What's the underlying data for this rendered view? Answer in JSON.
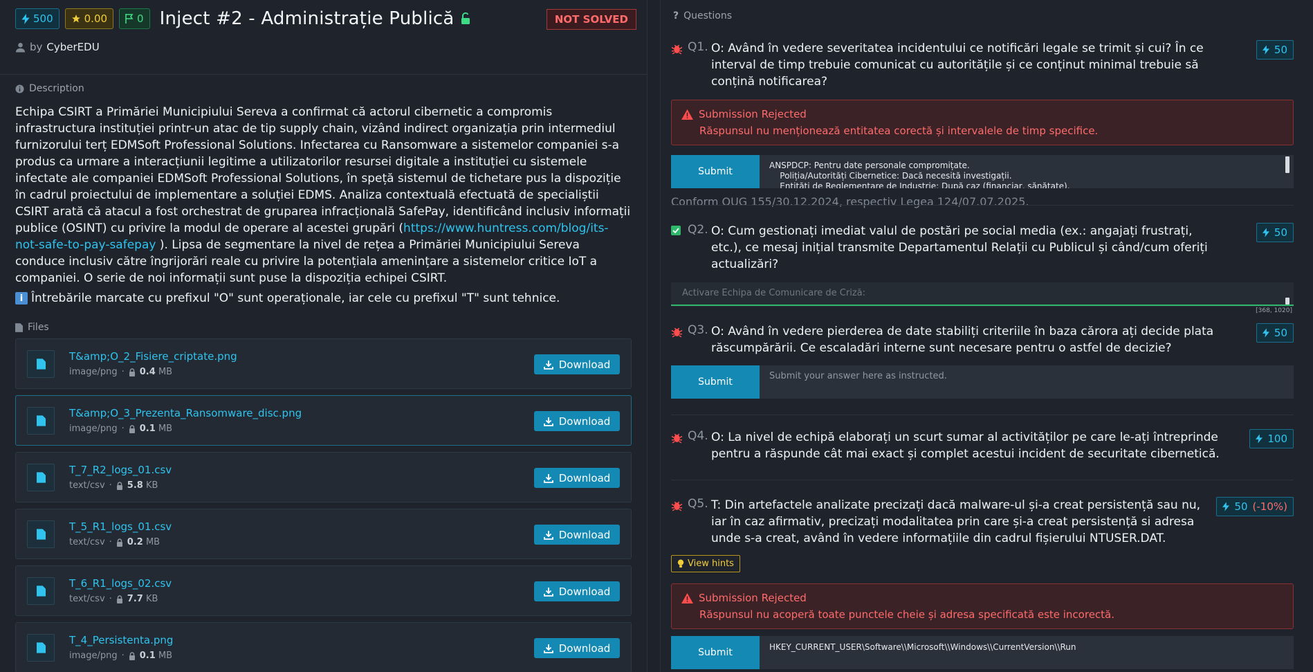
{
  "header": {
    "points": "500",
    "score": "0.00",
    "flags": "0",
    "title": "Inject #2 - Administrație Publică",
    "status": "NOT SOLVED",
    "by_label": "by",
    "author": "CyberEDU"
  },
  "description": {
    "label": "Description",
    "text_before_link": "Echipa CSIRT a Primăriei Municipiului Sereva a confirmat că actorul cibernetic a compromis infrastructura instituției printr-un atac de tip supply chain, vizând indirect organizația prin intermediul furnizorului terț EDMSoft Professional Solutions. Infectarea cu Ransomware a sistemelor companiei s-a produs ca urmare a interacțiunii legitime a utilizatorilor resursei digitale a instituției cu sistemele infectate ale companiei EDMSoft Professional Solutions, în speță sistemul de tichetare pus la dispoziție în cadrul proiectului de implementare a soluției EDMS. Analiza contextuală efectuată de specialiștii CSIRT arată că atacul a fost orchestrat de gruparea infracțională SafePay, identificând inclusiv informații publice (OSINT) cu privire la modul de operare al acestei grupări (",
    "link": "https://www.huntress.com/blog/its-not-safe-to-pay-safepay",
    "text_after_link": " ). Lipsa de segmentare la nivel de rețea a Primăriei Municipiului Sereva conduce inclusiv către îngrijorări reale cu privire la potențiala amenințare a sistemelor critice IoT a companiei. O serie de noi informații sunt puse la dispoziția echipei CSIRT.",
    "note": "Întrebările marcate cu prefixul \"O\" sunt operaționale, iar cele cu prefixul \"T\" sunt tehnice."
  },
  "files": {
    "label": "Files",
    "download_label": "Download",
    "items": [
      {
        "name": "T&amp;O_2_Fisiere_criptate.png",
        "type": "image/png",
        "size": "0.4",
        "unit": "MB"
      },
      {
        "name": "T&amp;O_3_Prezenta_Ransomware_disc.png",
        "type": "image/png",
        "size": "0.1",
        "unit": "MB"
      },
      {
        "name": "T_7_R2_logs_01.csv",
        "type": "text/csv",
        "size": "5.8",
        "unit": "KB"
      },
      {
        "name": "T_5_R1_logs_01.csv",
        "type": "text/csv",
        "size": "0.2",
        "unit": "MB"
      },
      {
        "name": "T_6_R1_logs_02.csv",
        "type": "text/csv",
        "size": "7.7",
        "unit": "KB"
      },
      {
        "name": "T_4_Persistenta.png",
        "type": "image/png",
        "size": "0.1",
        "unit": "MB"
      }
    ]
  },
  "questions": {
    "label": "Questions",
    "submit_label": "Submit",
    "placeholder": "Submit your answer here as instructed.",
    "rejected_title": "Submission Rejected",
    "q1": {
      "num": "Q1.",
      "text": "O: Având în vedere severitatea incidentului ce notificări legale se trimit și cui? În ce interval de timp trebuie comunicat cu autoritățile și ce conținut minimal trebuie să conțină notificarea?",
      "points": "50",
      "rejected_msg": "Răspunsul nu menționează entitatea corectă și intervalele de timp specifice.",
      "answer": "ANSPDCP: Pentru date personale compromițate.\n    Poliția/Autorități Cibernetice: Dacă necesită investigații.\n    Entități de Reglementare de Industrie: După caz (financiar, sănătate).",
      "note": "Conform OUG 155/30.12.2024, respectiv Legea 124/07.07.2025."
    },
    "q2": {
      "num": "Q2.",
      "text": "O: Cum gestionați imediat valul de postări pe social media (ex.: angajați frustrați, etc.), ce mesaj inițial transmite Departamentul Relații cu Publicul și când/cum oferiți actualizări?",
      "points": "50",
      "answer": "Activare Echipa de Comunicare de Criză:",
      "coords": "[368, 1020]"
    },
    "q3": {
      "num": "Q3.",
      "text": "O: Având în vedere pierderea de date stabiliți criteriile în baza cărora ați decide plata răscumpărării. Ce escaladări interne sunt necesare pentru o astfel de decizie?",
      "points": "50"
    },
    "q4": {
      "num": "Q4.",
      "text": "O: La nivel de echipă elaborați un scurt sumar al activităților pe care le-ați întreprinde pentru a răspunde cât mai exact și complet acestui incident de securitate cibernetică.",
      "points": "100"
    },
    "q5": {
      "num": "Q5.",
      "text": "T: Din artefactele analizate precizați dacă malware-ul și-a creat persistență sau nu, iar în caz afirmativ, precizați modalitatea prin care și-a creat persistență si adresa unde s-a creat, având în vedere informațiile din cadrul fișierului NTUSER.DAT.",
      "points": "50",
      "penalty": "(-10%)",
      "hints_label": "View hints",
      "rejected_msg": "Răspunsul nu acoperă toate punctele cheie și adresa specificată este incorectă.",
      "answer": "HKEY_CURRENT_USER\\Software\\\\Microsoft\\\\Windows\\\\CurrentVersion\\\\Run"
    }
  },
  "colors": {
    "accent": "#1489b3",
    "link": "#2fc3ee",
    "danger": "#ff6b6b",
    "success": "#2fb86b",
    "warning": "#f2cd3b"
  }
}
